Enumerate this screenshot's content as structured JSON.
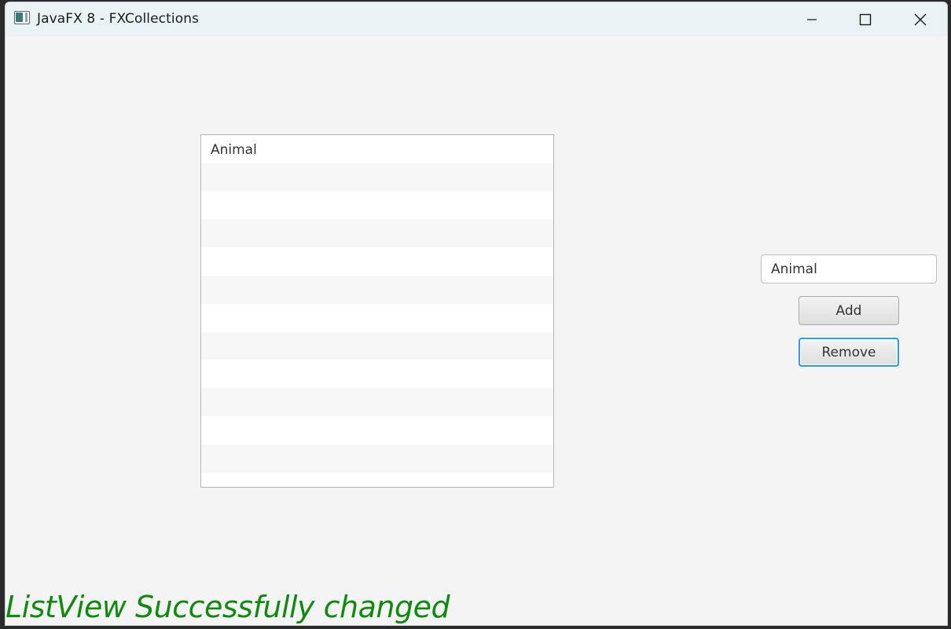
{
  "window": {
    "title": "JavaFX 8 - FXCollections"
  },
  "list": {
    "items": [
      "Animal"
    ],
    "empty_rows": 12
  },
  "form": {
    "input_value": "Animal",
    "add_label": "Add",
    "remove_label": "Remove"
  },
  "status": {
    "message": "ListView Successfully changed",
    "color": "#0f8a0f"
  },
  "colors": {
    "focus_accent": "#2a9fd6"
  }
}
